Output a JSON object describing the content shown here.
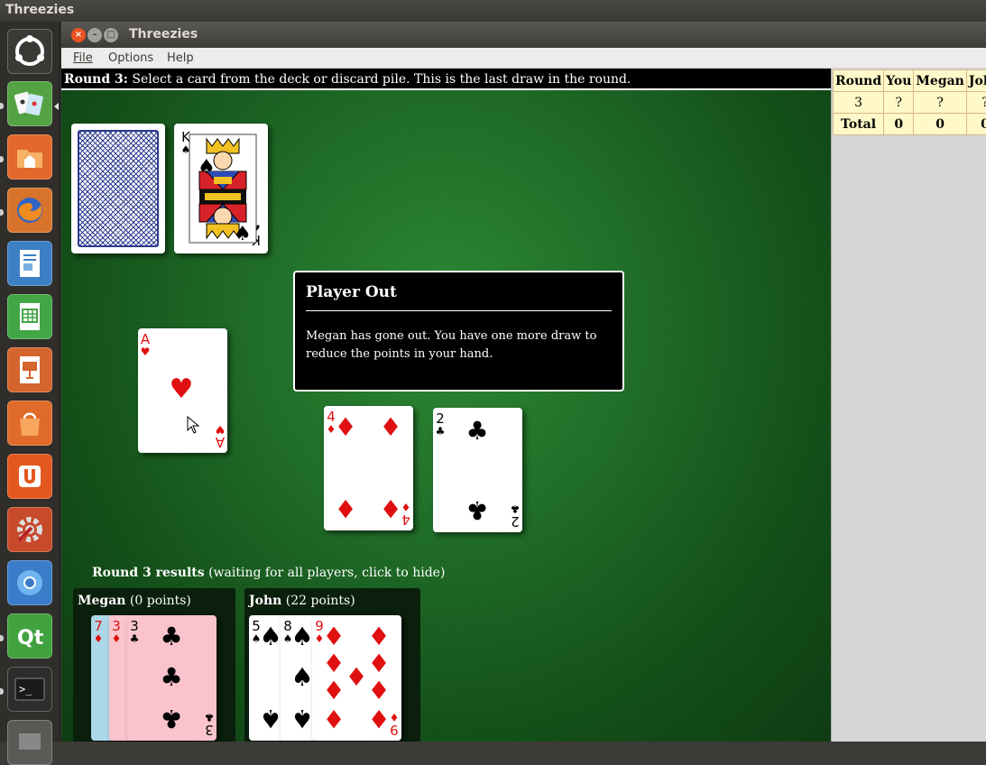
{
  "desktop": {
    "title": "Threezies"
  },
  "launcher": {
    "items": [
      "dash-home",
      "threezies",
      "files",
      "firefox",
      "writer",
      "calc",
      "impress",
      "software-center",
      "ubuntu-one",
      "system-settings",
      "chromium",
      "qt-creator",
      "terminal",
      "workspace-switcher"
    ]
  },
  "window": {
    "title": "Threezies",
    "controls": {
      "close": "×",
      "minimize": "–",
      "maximize": "□"
    },
    "menu": {
      "file": "File",
      "options": "Options",
      "help": "Help"
    }
  },
  "status": {
    "label": "Round 3:",
    "message": "Select a card from the deck or discard pile. This is the last draw in the round."
  },
  "piles": {
    "discard_top": {
      "rank": "K",
      "suit": "♠",
      "color": "black"
    }
  },
  "dialog": {
    "title": "Player Out",
    "body": "Megan has gone out. You have one more draw to reduce the points in your hand."
  },
  "hand": [
    {
      "rank": "A",
      "suit": "♥",
      "color": "red"
    },
    {
      "rank": "4",
      "suit": "♦",
      "color": "red"
    },
    {
      "rank": "2",
      "suit": "♣",
      "color": "black"
    }
  ],
  "results": {
    "title": "Round 3 results",
    "note": "(waiting for all players, click to hide)",
    "players": [
      {
        "name": "Megan",
        "points": "(0 points)",
        "cards": [
          {
            "rank": "7",
            "suit": "♦",
            "color": "red"
          },
          {
            "rank": "3",
            "suit": "♦",
            "color": "red"
          },
          {
            "rank": "3",
            "suit": "♣",
            "color": "black"
          }
        ]
      },
      {
        "name": "John",
        "points": "(22 points)",
        "cards": [
          {
            "rank": "5",
            "suit": "♠",
            "color": "black"
          },
          {
            "rank": "8",
            "suit": "♠",
            "color": "black"
          },
          {
            "rank": "9",
            "suit": "♦",
            "color": "red"
          }
        ]
      }
    ]
  },
  "scoreboard": {
    "headers": [
      "Round",
      "You",
      "Megan",
      "John"
    ],
    "rows": [
      [
        "3",
        "?",
        "?",
        "?"
      ]
    ],
    "total": [
      "Total",
      "0",
      "0",
      "0"
    ]
  },
  "colors": {
    "felt": "#1f6f28",
    "card_red": "#e01010",
    "score_bg": "#fff8c8",
    "megan_highlight": "#fbc4cc",
    "card_back": "#2b3a8f"
  }
}
